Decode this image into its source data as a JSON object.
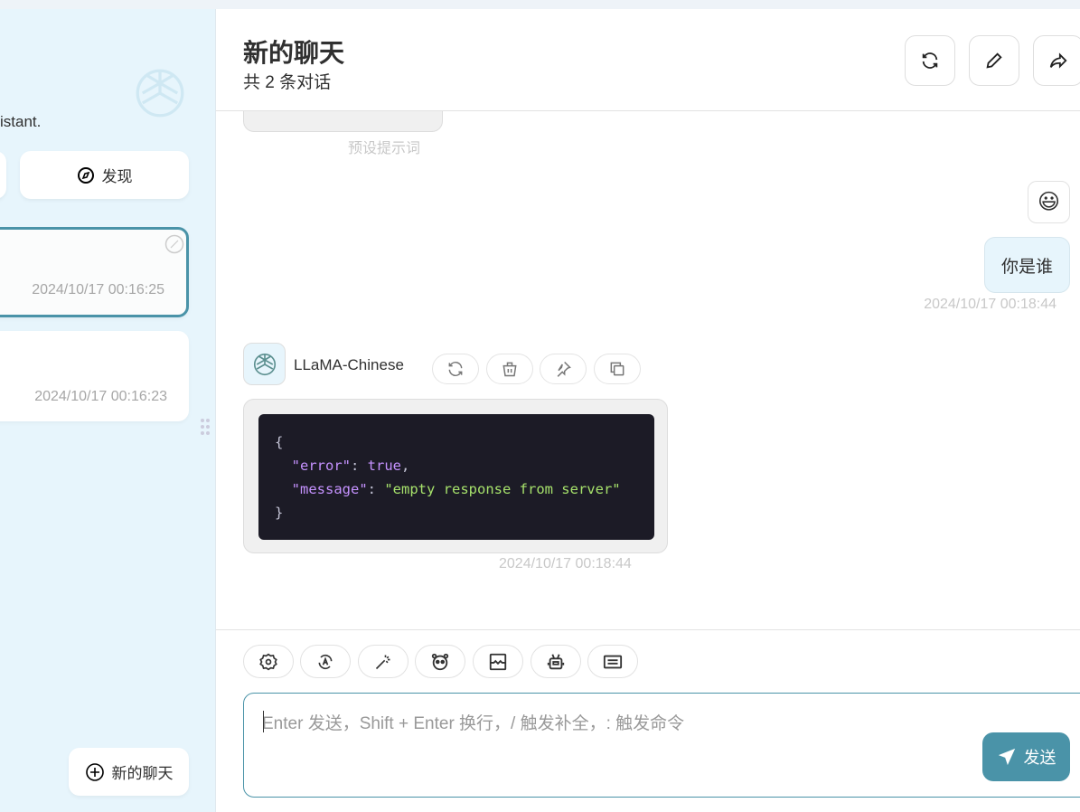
{
  "sidebar": {
    "subtitle": "istant.",
    "discover_label": "发现",
    "sessions": [
      {
        "time": "2024/10/17 00:16:25",
        "selected": true
      },
      {
        "time": "2024/10/17 00:16:23",
        "selected": false
      }
    ],
    "new_chat_label": "新的聊天"
  },
  "header": {
    "title": "新的聊天",
    "count": "共 2 条对话"
  },
  "messages": {
    "preset_label": "预设提示词",
    "user": {
      "emoji": "😃",
      "text": "你是谁",
      "time": "2024/10/17 00:18:44"
    },
    "bot": {
      "model": "LLaMA-Chinese",
      "time": "2024/10/17 00:18:44",
      "code": {
        "open": "{",
        "k1": "\"error\"",
        "v1": "true",
        "k2": "\"message\"",
        "v2": "\"empty response from server\"",
        "close": "}"
      }
    }
  },
  "input": {
    "placeholder": "Enter 发送，Shift + Enter 换行，/ 触发补全，: 触发命令",
    "send_label": "发送"
  },
  "colors": {
    "accent": "#4a93a8",
    "sidebar_bg": "#e7f5fc",
    "code_bg": "#1c1b26"
  }
}
